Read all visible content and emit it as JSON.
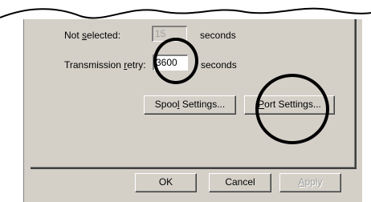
{
  "panel": {
    "not_selected": {
      "label_pre": "Not ",
      "label_key": "s",
      "label_post": "elected:",
      "value": "15",
      "unit": "seconds"
    },
    "transmission_retry": {
      "label_pre": "Transmission ",
      "label_key": "r",
      "label_post": "etry:",
      "value": "3600",
      "unit": "seconds"
    },
    "spool_settings": {
      "pre": "Spoo",
      "key": "l",
      "post": " Settings..."
    },
    "port_settings": {
      "pre": "",
      "key": "P",
      "post": "ort Settings..."
    }
  },
  "footer": {
    "ok": "OK",
    "cancel": "Cancel",
    "apply": {
      "pre": "",
      "key": "A",
      "post": "pply"
    }
  },
  "highlights": [
    "transmission-retry-field",
    "port-settings-button"
  ]
}
